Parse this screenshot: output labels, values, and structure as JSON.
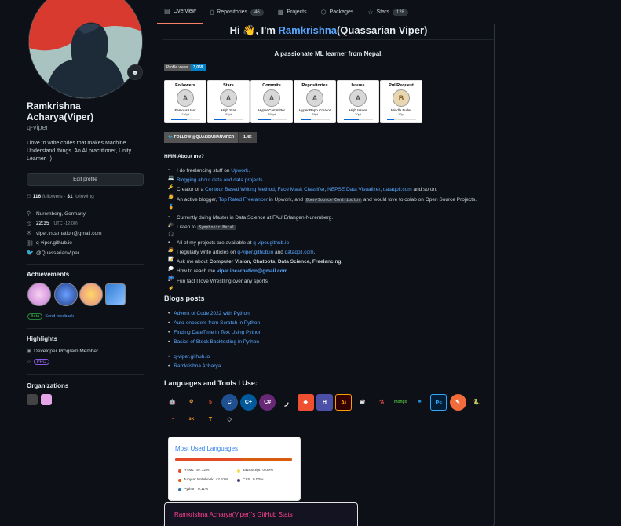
{
  "nav": {
    "tabs": [
      {
        "label": "Overview",
        "icon": "book-icon"
      },
      {
        "label": "Repositories",
        "icon": "repo-icon",
        "count": "46"
      },
      {
        "label": "Projects",
        "icon": "project-icon"
      },
      {
        "label": "Packages",
        "icon": "package-icon"
      },
      {
        "label": "Stars",
        "icon": "star-icon",
        "count": "128"
      }
    ]
  },
  "profile": {
    "name": "Ramkrishna Acharya(Viper)",
    "login": "q-viper",
    "bio": "I love to write codes that makes Machine Understand things. An AI practitioner, Unity Learner. :)",
    "edit_label": "Edit profile",
    "followers": "116",
    "followers_label": "followers",
    "following": "31",
    "following_label": "following",
    "location": "Nuremberg, Germany",
    "time": "22:35",
    "time_zone": "(UTC -12:00)",
    "email": "viper.incarnation@gmail.com",
    "website": "q-viper.github.io",
    "twitter": "@QuassarianViper"
  },
  "achievements": {
    "title": "Achievements",
    "beta_label": "Beta",
    "feedback_label": "Send feedback"
  },
  "highlights": {
    "title": "Highlights",
    "item": "Developer Program Member",
    "pro_label": "PRO"
  },
  "organizations": {
    "title": "Organizations"
  },
  "readme": {
    "greeting_pre": "Hi 👋, I'm ",
    "greeting_name": "Ramkrishna",
    "greeting_post": "(Quassarian Viper)",
    "subtitle": "A passionate ML learner from Nepal.",
    "views_label": "Profile views",
    "views_count": "3,069",
    "trophies": [
      {
        "title": "Followers",
        "grade": "A",
        "rank": "Famous User",
        "points": "116pt",
        "progress": 0.55
      },
      {
        "title": "Stars",
        "grade": "A",
        "rank": "High Star",
        "points": "97pt",
        "progress": 0.4
      },
      {
        "title": "Commits",
        "grade": "A",
        "rank": "Hyper Committer",
        "points": "492pt",
        "progress": 0.45
      },
      {
        "title": "Repositories",
        "grade": "A",
        "rank": "Hyper Repo Creator",
        "points": "28pt",
        "progress": 0.35
      },
      {
        "title": "Issues",
        "grade": "A",
        "rank": "High Issuer",
        "points": "20pt",
        "progress": 0.5
      },
      {
        "title": "PullRequest",
        "grade": "B",
        "rank": "Middle Puller",
        "points": "12pt",
        "progress": 0.25
      }
    ],
    "follow_label": "FOLLOW @QUASSARIANVIPER",
    "follow_count": "1.4K",
    "about_heading": "HMM About me?",
    "about_heading_text": "HMM About me?",
    "langs_heading": "Languages and Tools I Use:",
    "blogs_heading": "Blogs posts",
    "blog_posts": [
      "Advent of Code 2022 with Python",
      "Auto-encoders from Scratch in Python",
      "Finding DateTime in Text Using Python",
      "Basics of Stock Backtesting in Python"
    ],
    "links": [
      "q-viper.github.io",
      "Ramkrishna Acharya"
    ],
    "lang_card": {
      "title": "Most Used Languages",
      "items": [
        {
          "name": "HTML",
          "percent": "57.12%",
          "color": "#e34c26"
        },
        {
          "name": "JavaScript",
          "percent": "0.09%",
          "color": "#f1e05a"
        },
        {
          "name": "Jupyter Notebook",
          "percent": "42.62%",
          "color": "#da5b0b"
        },
        {
          "name": "CSS",
          "percent": "0.00%",
          "color": "#563d7c"
        },
        {
          "name": "Python",
          "percent": "0.11%",
          "color": "#3572a5"
        }
      ]
    },
    "stats_title": "Ramkrishna Acharya(Viper)'s GitHub Stats"
  }
}
